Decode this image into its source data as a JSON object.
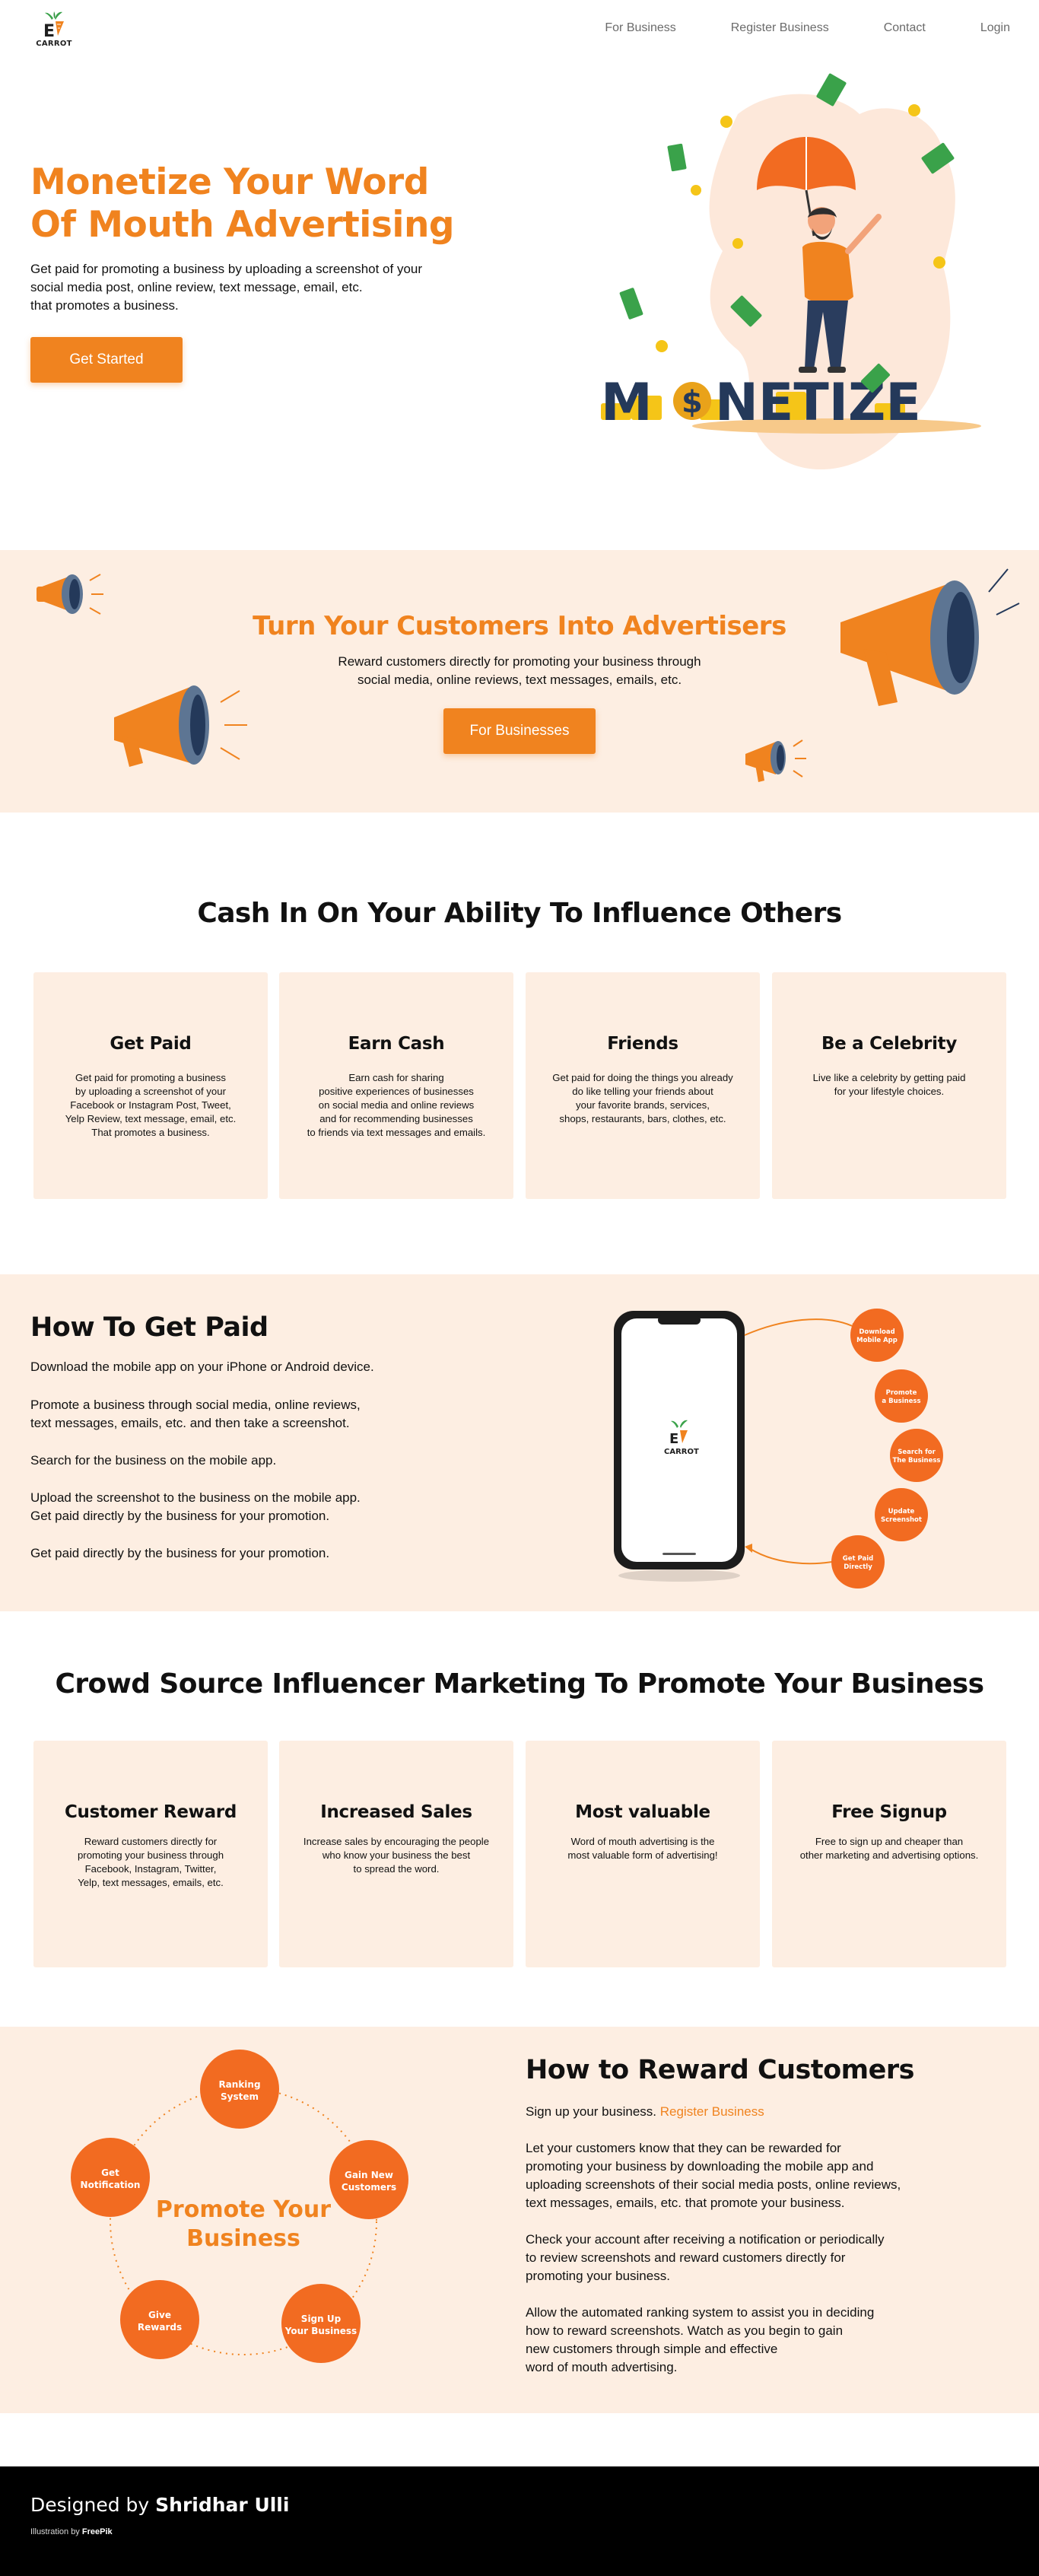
{
  "brand": {
    "logo_text": "CARROT"
  },
  "nav": {
    "items": [
      {
        "label": "For Business"
      },
      {
        "label": "Register Business"
      },
      {
        "label": "Contact"
      },
      {
        "label": "Login"
      }
    ]
  },
  "hero": {
    "title_line1": "Monetize Your Word",
    "title_line2": "Of Mouth Advertising",
    "desc_line1": "Get paid for promoting a business by uploading a screenshot of your",
    "desc_line2": "social media post, online review, text message, email, etc.",
    "desc_line3": "that promotes a business.",
    "button": "Get Started",
    "art_word": "MONETIZE"
  },
  "advertisers": {
    "title": "Turn Your Customers Into Advertisers",
    "desc_line1": "Reward customers directly for promoting your business through",
    "desc_line2": "social media, online reviews, text messages, emails, etc.",
    "button": "For Businesses"
  },
  "influence": {
    "title": "Cash In On Your Ability To Influence Others",
    "cards": [
      {
        "title": "Get Paid",
        "lines": [
          "Get paid for promoting a business",
          "by uploading a screenshot of your",
          "Facebook or Instagram Post, Tweet,",
          "Yelp Review, text message, email, etc.",
          "That promotes a business."
        ]
      },
      {
        "title": "Earn Cash",
        "lines": [
          "Earn cash for sharing",
          "positive experiences of businesses",
          "on social media and online reviews",
          "and for recommending businesses",
          "to friends via text messages and emails."
        ]
      },
      {
        "title": "Friends",
        "lines": [
          "Get paid for doing the things you already",
          "do like telling your friends about",
          "your favorite brands, services,",
          "shops, restaurants, bars, clothes, etc.",
          ""
        ]
      },
      {
        "title": "Be a Celebrity",
        "lines": [
          "Live like a celebrity by getting paid",
          "for your lifestyle choices.",
          "",
          "",
          ""
        ]
      }
    ]
  },
  "how_paid": {
    "title": "How To Get Paid",
    "p1": "Download the mobile app on your iPhone or Android device.",
    "p2_line1": "Promote a business through social media, online reviews,",
    "p2_line2": "text messages, emails, etc. and then take a screenshot.",
    "p3": "Search for the business on the mobile app.",
    "p4_line1": "Upload the screenshot to the business on the mobile app.",
    "p4_line2": "Get paid directly by the business for your promotion.",
    "p5": "Get paid directly by the business for your promotion.",
    "steps": [
      {
        "line1": "Download",
        "line2": "Mobile App"
      },
      {
        "line1": "Promote",
        "line2": "a Business"
      },
      {
        "line1": "Search for",
        "line2": "The Business"
      },
      {
        "line1": "Update",
        "line2": "Screenshot"
      },
      {
        "line1": "Get Paid",
        "line2": "Directly"
      }
    ]
  },
  "crowd": {
    "title": "Crowd Source Influencer Marketing To Promote Your Business",
    "cards": [
      {
        "title": "Customer Reward",
        "lines": [
          "Reward customers directly for",
          "promoting your business through",
          "Facebook, Instagram, Twitter,",
          "Yelp, text messages, emails, etc."
        ]
      },
      {
        "title": "Increased Sales",
        "lines": [
          "Increase sales by encouraging the people",
          "who know your business the best",
          "to spread the word.",
          ""
        ]
      },
      {
        "title": "Most valuable",
        "lines": [
          "Word of mouth advertising is the",
          "most valuable form of advertising!",
          "",
          ""
        ]
      },
      {
        "title": "Free Signup",
        "lines": [
          "Free to sign up and cheaper than",
          "other marketing and advertising options.",
          "",
          ""
        ]
      }
    ]
  },
  "reward": {
    "cycle_center_line1": "Promote Your",
    "cycle_center_line2": "Business",
    "cycle": [
      {
        "line1": "Ranking",
        "line2": "System"
      },
      {
        "line1": "Gain New",
        "line2": "Customers"
      },
      {
        "line1": "Sign Up",
        "line2": "Your Business"
      },
      {
        "line1": "Give",
        "line2": "Rewards"
      },
      {
        "line1": "Get",
        "line2": "Notification"
      }
    ],
    "title": "How to Reward Customers",
    "p1_text": "Sign up your business.",
    "p1_link": "Register Business",
    "p2_line1": "Let your customers know that they can be rewarded for",
    "p2_line2": "promoting your business by downloading the mobile app and",
    "p2_line3": "uploading screenshots of their social media posts, online reviews,",
    "p2_line4": "text messages, emails, etc. that promote your business.",
    "p3_line1": "Check your account after receiving a notification or periodically",
    "p3_line2": "to review screenshots and reward customers directly for",
    "p3_line3": "promoting your business.",
    "p4_line1": "Allow the automated ranking system to assist you in deciding",
    "p4_line2": "how to reward screenshots. Watch as you begin to gain",
    "p4_line3": "new customers through simple and effective",
    "p4_line4": "word of mouth advertising."
  },
  "footer": {
    "designed_by": "Designed by",
    "designer": "Shridhar Ulli",
    "illustration_by": "Illustration by",
    "illustrator": "FreePik"
  },
  "colors": {
    "accent": "#f0831f",
    "band": "#fdeee2",
    "footer": "#000000"
  }
}
